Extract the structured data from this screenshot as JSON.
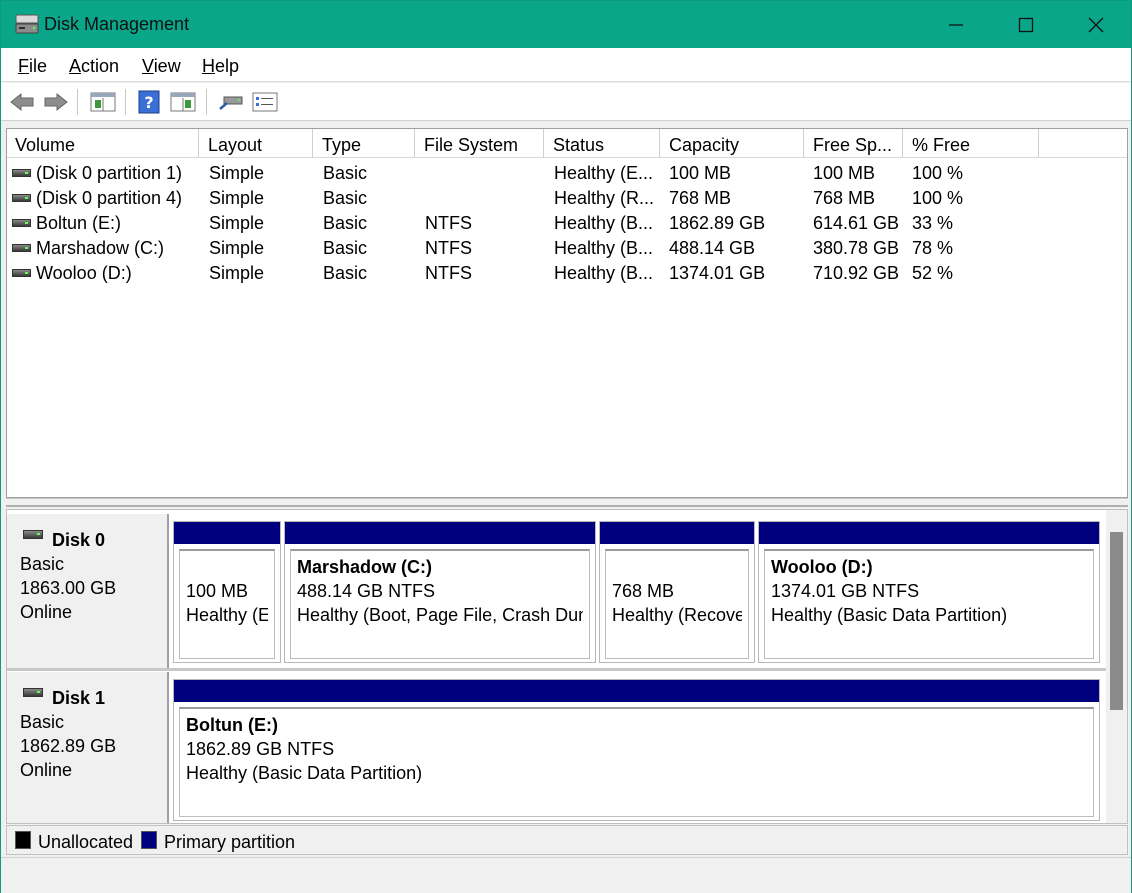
{
  "window": {
    "title": "Disk Management"
  },
  "menu": {
    "file": "File",
    "action": "Action",
    "view": "View",
    "help": "Help"
  },
  "toolbar": [
    "back-icon",
    "forward-icon",
    "console-tree-icon",
    "help-icon",
    "action-pane-icon",
    "rescan-icon",
    "properties-icon"
  ],
  "volumes": {
    "columns": [
      "Volume",
      "Layout",
      "Type",
      "File System",
      "Status",
      "Capacity",
      "Free Sp...",
      "% Free"
    ],
    "rows": [
      [
        "(Disk 0 partition 1)",
        "Simple",
        "Basic",
        "",
        "Healthy (E...",
        "100 MB",
        "100 MB",
        "100 %"
      ],
      [
        "(Disk 0 partition 4)",
        "Simple",
        "Basic",
        "",
        "Healthy (R...",
        "768 MB",
        "768 MB",
        "100 %"
      ],
      [
        "Boltun (E:)",
        "Simple",
        "Basic",
        "NTFS",
        "Healthy (B...",
        "1862.89 GB",
        "614.61 GB",
        "33 %"
      ],
      [
        "Marshadow (C:)",
        "Simple",
        "Basic",
        "NTFS",
        "Healthy (B...",
        "488.14 GB",
        "380.78 GB",
        "78 %"
      ],
      [
        "Wooloo (D:)",
        "Simple",
        "Basic",
        "NTFS",
        "Healthy (B...",
        "1374.01 GB",
        "710.92 GB",
        "52 %"
      ]
    ]
  },
  "disks": [
    {
      "name": "Disk 0",
      "type": "Basic",
      "size": "1863.00 GB",
      "state": "Online",
      "partitions": [
        {
          "title": "",
          "line1": "100 MB",
          "line2": "Healthy (EFI System Partition)"
        },
        {
          "title": "Marshadow  (C:)",
          "line1": "488.14 GB NTFS",
          "line2": "Healthy (Boot, Page File, Crash Dump, Basic Data Partition)"
        },
        {
          "title": "",
          "line1": "768 MB",
          "line2": "Healthy (Recovery Partition)"
        },
        {
          "title": "Wooloo  (D:)",
          "line1": "1374.01 GB NTFS",
          "line2": "Healthy (Basic Data Partition)"
        }
      ]
    },
    {
      "name": "Disk 1",
      "type": "Basic",
      "size": "1862.89 GB",
      "state": "Online",
      "partitions": [
        {
          "title": "Boltun  (E:)",
          "line1": "1862.89 GB NTFS",
          "line2": "Healthy (Basic Data Partition)"
        }
      ]
    }
  ],
  "legend": {
    "unallocated": "Unallocated",
    "primary": "Primary partition",
    "unallocated_color": "#000000",
    "primary_color": "#00007f"
  },
  "colors": {
    "titlebar": "#0aa68a",
    "partition_bar": "#00007f"
  }
}
